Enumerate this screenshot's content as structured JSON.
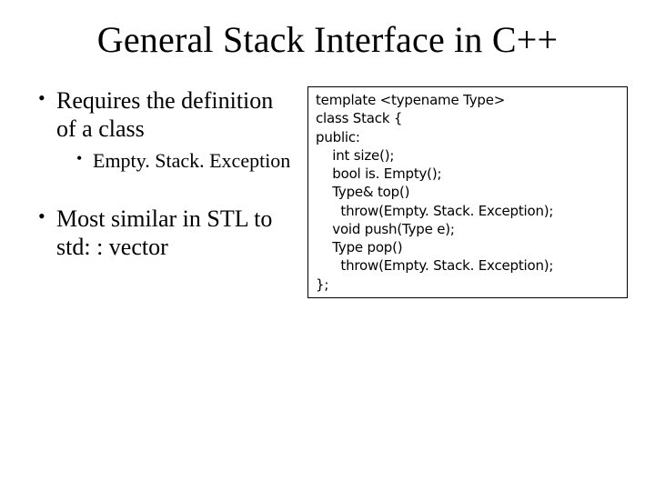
{
  "title": "General Stack Interface in C++",
  "bullets": {
    "b1": "Requires the definition of a class",
    "b1a": "Empty. Stack. Exception",
    "b2": "Most similar in STL to std: : vector"
  },
  "code": "template <typename Type>\nclass Stack {\npublic:\n    int size();\n    bool is. Empty();\n    Type& top()\n      throw(Empty. Stack. Exception);\n    void push(Type e);\n    Type pop()\n      throw(Empty. Stack. Exception);\n};"
}
